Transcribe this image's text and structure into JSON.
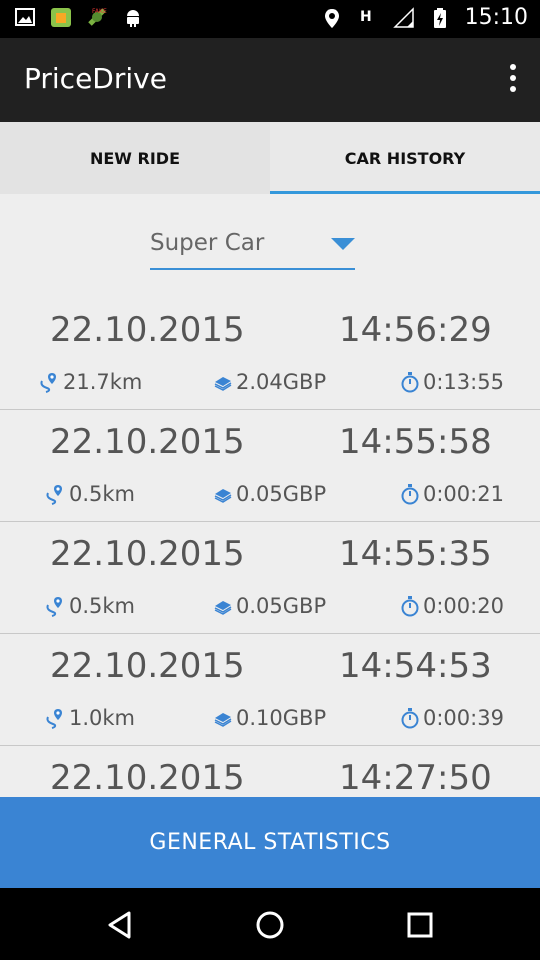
{
  "status_bar": {
    "time": "15:10",
    "left_icons": [
      "gallery-icon",
      "app-icon",
      "fake-gps-icon",
      "android-icon"
    ],
    "right_icons": [
      "location-icon",
      "h-network-icon",
      "signal-icon",
      "battery-charging-icon"
    ]
  },
  "app_bar": {
    "title": "PriceDrive",
    "menu_icon": "overflow-menu-icon"
  },
  "tabs": [
    {
      "label": "NEW RIDE",
      "active": false
    },
    {
      "label": "CAR HISTORY",
      "active": true
    }
  ],
  "car_selector": {
    "value": "Super Car"
  },
  "rides": [
    {
      "date": "22.10.2015",
      "time": "14:56:29",
      "distance": "21.7km",
      "cost": "2.04GBP",
      "duration": "0:13:55"
    },
    {
      "date": "22.10.2015",
      "time": "14:55:58",
      "distance": "0.5km",
      "cost": "0.05GBP",
      "duration": "0:00:21"
    },
    {
      "date": "22.10.2015",
      "time": "14:55:35",
      "distance": "0.5km",
      "cost": "0.05GBP",
      "duration": "0:00:20"
    },
    {
      "date": "22.10.2015",
      "time": "14:54:53",
      "distance": "1.0km",
      "cost": "0.10GBP",
      "duration": "0:00:39"
    },
    {
      "date": "22.10.2015",
      "time": "14:27:50",
      "distance": "",
      "cost": "",
      "duration": ""
    }
  ],
  "stats_button": {
    "label": "GENERAL STATISTICS"
  },
  "colors": {
    "accent": "#3a84d3",
    "app_bar": "#212121",
    "background": "#eeeeee"
  }
}
